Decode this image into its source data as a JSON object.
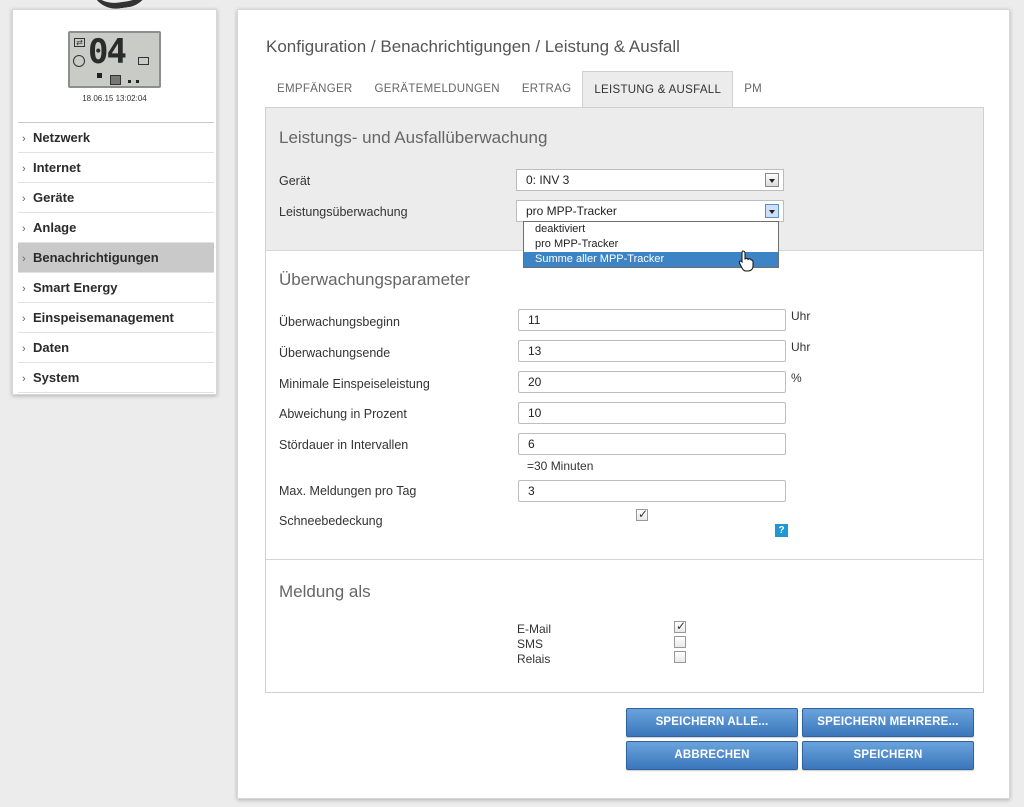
{
  "device": {
    "lcd_value": "04",
    "datetime": "18.06.15 13:02:04"
  },
  "sidebar": {
    "items": [
      {
        "label": "Netzwerk"
      },
      {
        "label": "Internet"
      },
      {
        "label": "Geräte"
      },
      {
        "label": "Anlage"
      },
      {
        "label": "Benachrichtigungen",
        "active": true
      },
      {
        "label": "Smart Energy"
      },
      {
        "label": "Einspeisemanagement"
      },
      {
        "label": "Daten"
      },
      {
        "label": "System"
      }
    ]
  },
  "breadcrumb": "Konfiguration / Benachrichtigungen / Leistung & Ausfall",
  "tabs": [
    {
      "label": "EMPFÄNGER"
    },
    {
      "label": "GERÄTEMELDUNGEN"
    },
    {
      "label": "ERTRAG"
    },
    {
      "label": "LEISTUNG & AUSFALL",
      "active": true
    },
    {
      "label": "PM"
    }
  ],
  "section1": {
    "title": "Leistungs- und Ausfallüberwachung",
    "device_label": "Gerät",
    "device_value": "0: INV 3",
    "monitoring_label": "Leistungsüberwachung",
    "monitoring_value": "pro MPP-Tracker",
    "monitoring_options": [
      "deaktiviert",
      "pro MPP-Tracker",
      "Summe aller MPP-Tracker"
    ],
    "highlighted_option": "Summe aller MPP-Tracker"
  },
  "section2": {
    "title": "Überwachungsparameter",
    "start_label": "Überwachungsbeginn",
    "start_value": "11",
    "start_unit": "Uhr",
    "end_label": "Überwachungsende",
    "end_value": "13",
    "end_unit": "Uhr",
    "min_power_label": "Minimale Einspeiseleistung",
    "min_power_value": "20",
    "min_power_unit": "%",
    "deviation_label": "Abweichung in Prozent",
    "deviation_value": "10",
    "fault_label": "Stördauer in Intervallen",
    "fault_value": "6",
    "fault_hint": "=30 Minuten",
    "max_msg_label": "Max. Meldungen pro Tag",
    "max_msg_value": "3",
    "snow_label": "Schneebedeckung",
    "snow_checked": true,
    "help_text": "?"
  },
  "section3": {
    "title": "Meldung als",
    "options": [
      {
        "label": "E-Mail",
        "checked": true
      },
      {
        "label": "SMS",
        "checked": false
      },
      {
        "label": "Relais",
        "checked": false
      }
    ]
  },
  "buttons": {
    "save_all": "SPEICHERN ALLE...",
    "save_multiple": "SPEICHERN MEHRERE...",
    "cancel": "ABBRECHEN",
    "save": "SPEICHERN"
  },
  "colors": {
    "accent_button": "#4a86c8",
    "dropdown_highlight": "#3d84c6",
    "help_icon": "#1f97d4"
  }
}
